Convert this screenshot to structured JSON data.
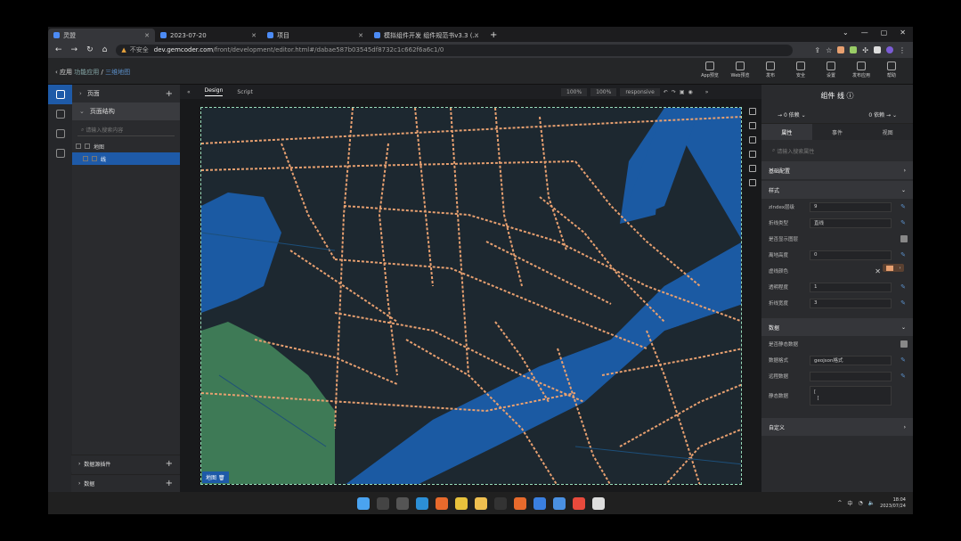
{
  "browser": {
    "tabs": [
      {
        "label": "灵盟",
        "color": "#4c8bf5"
      },
      {
        "label": "2023-07-20",
        "color": "#4c8bf5"
      },
      {
        "label": "项目",
        "color": "#4c8bf5"
      },
      {
        "label": "模拟组件开发 组件规范书v3.3 (...",
        "color": "#4c8bf5"
      }
    ],
    "url_warning": "不安全",
    "url_host": "dev.gemcoder.com",
    "url_path": "/front/development/editor.html#/dabae587b03545df8732c1c662f6a6c1/0"
  },
  "header": {
    "crumbs": [
      "应用",
      "功能应用",
      "三维地图"
    ],
    "tools": [
      "App预览",
      "Web预览",
      "发布",
      "安全",
      "设置",
      "发布应用",
      "帮助"
    ]
  },
  "left": {
    "pages_label": "页面",
    "structure_label": "页面结构",
    "search_placeholder": "请输入搜索内容",
    "tree": [
      {
        "label": "地图"
      },
      {
        "label": "线"
      }
    ],
    "data_source_label": "数据源插件",
    "data_label": "数据"
  },
  "canvas": {
    "tabs": [
      "Design",
      "Script"
    ],
    "zoom1": "100%",
    "zoom2": "100%",
    "mode": "responsive",
    "tag": "地图"
  },
  "right": {
    "title": "组件 线",
    "dep_left": "0 依赖",
    "dep_right": "0 依赖",
    "tabs": [
      "属性",
      "事件",
      "视图"
    ],
    "search_placeholder": "请输入搜索属性",
    "sec_basic": "基础配置",
    "sec_style": "样式",
    "fields": [
      {
        "label": "zIndex层级",
        "value": "9"
      },
      {
        "label": "折线类型",
        "value": "直线"
      },
      {
        "label": "是否显示图层",
        "value": ""
      },
      {
        "label": "离地高度",
        "value": "0"
      },
      {
        "label": "虚线颜色",
        "value": ""
      },
      {
        "label": "透明程度",
        "value": "1"
      },
      {
        "label": "折线宽度",
        "value": "3"
      }
    ],
    "sec_data": "数据",
    "data_fields": [
      {
        "label": "是否静态数据",
        "value": ""
      },
      {
        "label": "数据格式",
        "value": "geojson格式"
      },
      {
        "label": "远程数据",
        "value": ""
      },
      {
        "label": "静态数据",
        "value": "[\n  ["
      }
    ],
    "sec_custom": "自定义",
    "line_color": "#e8a070"
  },
  "taskbar": {
    "time": "18:04",
    "date": "2023/07/24",
    "lang": "中"
  }
}
